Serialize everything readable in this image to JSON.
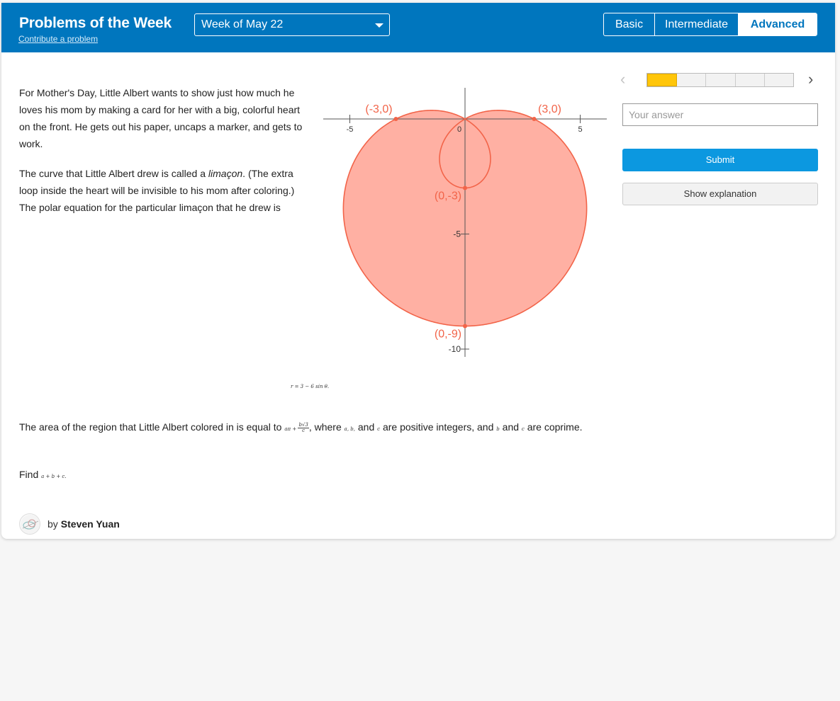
{
  "header": {
    "title": "Problems of the Week",
    "contribute_label": "Contribute a problem",
    "week_selected": "Week of May 22",
    "levels": [
      "Basic",
      "Intermediate",
      "Advanced"
    ],
    "active_level": "Advanced"
  },
  "problem": {
    "para1": "For Mother's Day, Little Albert wants to show just how much he loves his mom by making a card for her with a big, colorful heart on the front. He gets out his paper, uncaps a marker, and gets to work.",
    "para2_before": "The curve that Little Albert drew is called a ",
    "para2_term": "limaçon",
    "para2_after": ". (The extra loop inside the heart will be invisible to his mom after coloring.) The polar equation for the particular limaçon that he drew is",
    "equation": "r = 3 − 6 sin θ.",
    "para3_a": "The area of the region that Little Albert colored in is equal to ",
    "para3_expr_lead": "aπ + ",
    "para3_frac_num": "b√3",
    "para3_frac_den": "c",
    "para3_b": ", where ",
    "para3_vars": "a, b,",
    "para3_c": " and ",
    "para3_var_c": "c",
    "para3_d": " are positive integers, and ",
    "para3_var_b": "b",
    "para3_e": " and ",
    "para3_var_c2": "c",
    "para3_f": " are coprime.",
    "para4_a": "Find ",
    "para4_expr": "a + b + c.",
    "author_by": "by",
    "author_name": "Steven Yuan"
  },
  "graph": {
    "x_ticks": [
      "-5",
      "0",
      "5"
    ],
    "y_ticks": [
      "-5",
      "-10"
    ],
    "points": [
      {
        "label": "(-3,0)",
        "x": -3,
        "y": 0
      },
      {
        "label": "(3,0)",
        "x": 3,
        "y": 0
      },
      {
        "label": "(0,-3)",
        "x": 0,
        "y": -3
      },
      {
        "label": "(0,-9)",
        "x": 0,
        "y": -9
      }
    ],
    "fill_color": "#ffb0a3",
    "stroke_color": "#f26449"
  },
  "sidebar": {
    "progress_total": 5,
    "progress_current": 1,
    "answer_placeholder": "Your answer",
    "submit_label": "Submit",
    "explain_label": "Show explanation",
    "prev_icon": "‹",
    "next_icon": "›"
  },
  "colors": {
    "header_bg": "#0076be",
    "submit_bg": "#0c98e0",
    "progress_active": "#ffc60a"
  }
}
